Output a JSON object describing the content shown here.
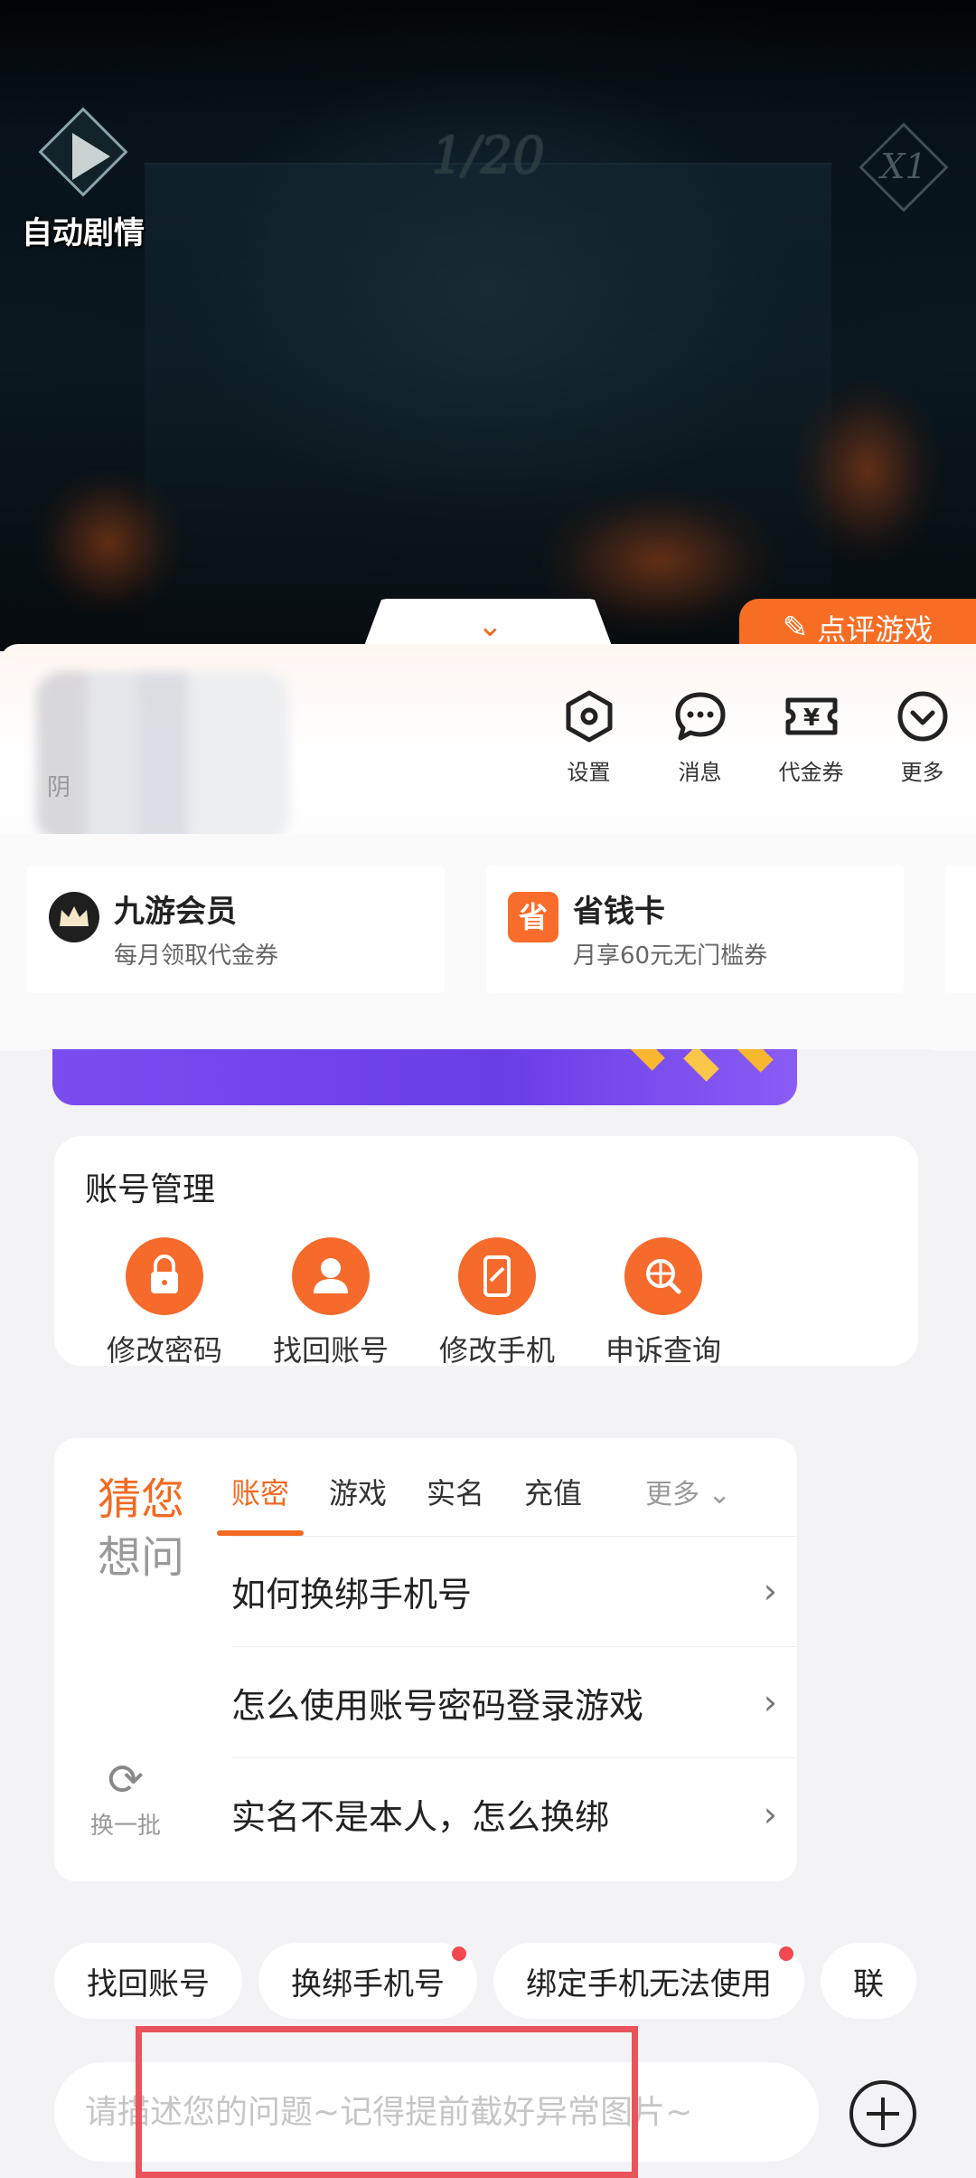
{
  "game": {
    "auto_play_label": "自动剧情",
    "page_counter": "1/20",
    "speed_label": "X1"
  },
  "rate_game": {
    "label": "点评游戏"
  },
  "user": {
    "hint": "阴"
  },
  "quick_actions": [
    {
      "label": "设置",
      "icon": "settings-hex-icon"
    },
    {
      "label": "消息",
      "icon": "message-bubble-icon"
    },
    {
      "label": "代金券",
      "icon": "coupon-ticket-icon"
    },
    {
      "label": "更多",
      "icon": "chevron-circle-icon"
    }
  ],
  "membership": [
    {
      "title": "九游会员",
      "subtitle": "每月领取代金券",
      "icon": "crown-icon"
    },
    {
      "title": "省钱卡",
      "subtitle": "月享60元无门槛券",
      "icon": "save-card-icon",
      "badge": "省"
    }
  ],
  "account_management": {
    "title": "账号管理",
    "items": [
      {
        "label": "修改密码",
        "icon": "lock-icon"
      },
      {
        "label": "找回账号",
        "icon": "user-icon"
      },
      {
        "label": "修改手机",
        "icon": "phone-edit-icon"
      },
      {
        "label": "申诉查询",
        "icon": "search-globe-icon"
      }
    ]
  },
  "guess": {
    "title_line1": "猜您",
    "title_line2": "想问",
    "refresh_label": "换一批",
    "tabs": [
      "账密",
      "游戏",
      "实名",
      "充值"
    ],
    "active_tab": "账密",
    "more_label": "更多",
    "questions": [
      "如何换绑手机号",
      "怎么使用账号密码登录游戏",
      "实名不是本人，怎么换绑"
    ]
  },
  "chips": [
    {
      "label": "找回账号",
      "dot": false
    },
    {
      "label": "换绑手机号",
      "dot": true
    },
    {
      "label": "绑定手机无法使用",
      "dot": true
    },
    {
      "label": "联",
      "dot": false
    }
  ],
  "input": {
    "placeholder": "请描述您的问题~记得提前截好异常图片~"
  },
  "colors": {
    "accent": "#f26a21",
    "highlight_box": "#e9535a",
    "banner_purple": "#7a4df0"
  }
}
